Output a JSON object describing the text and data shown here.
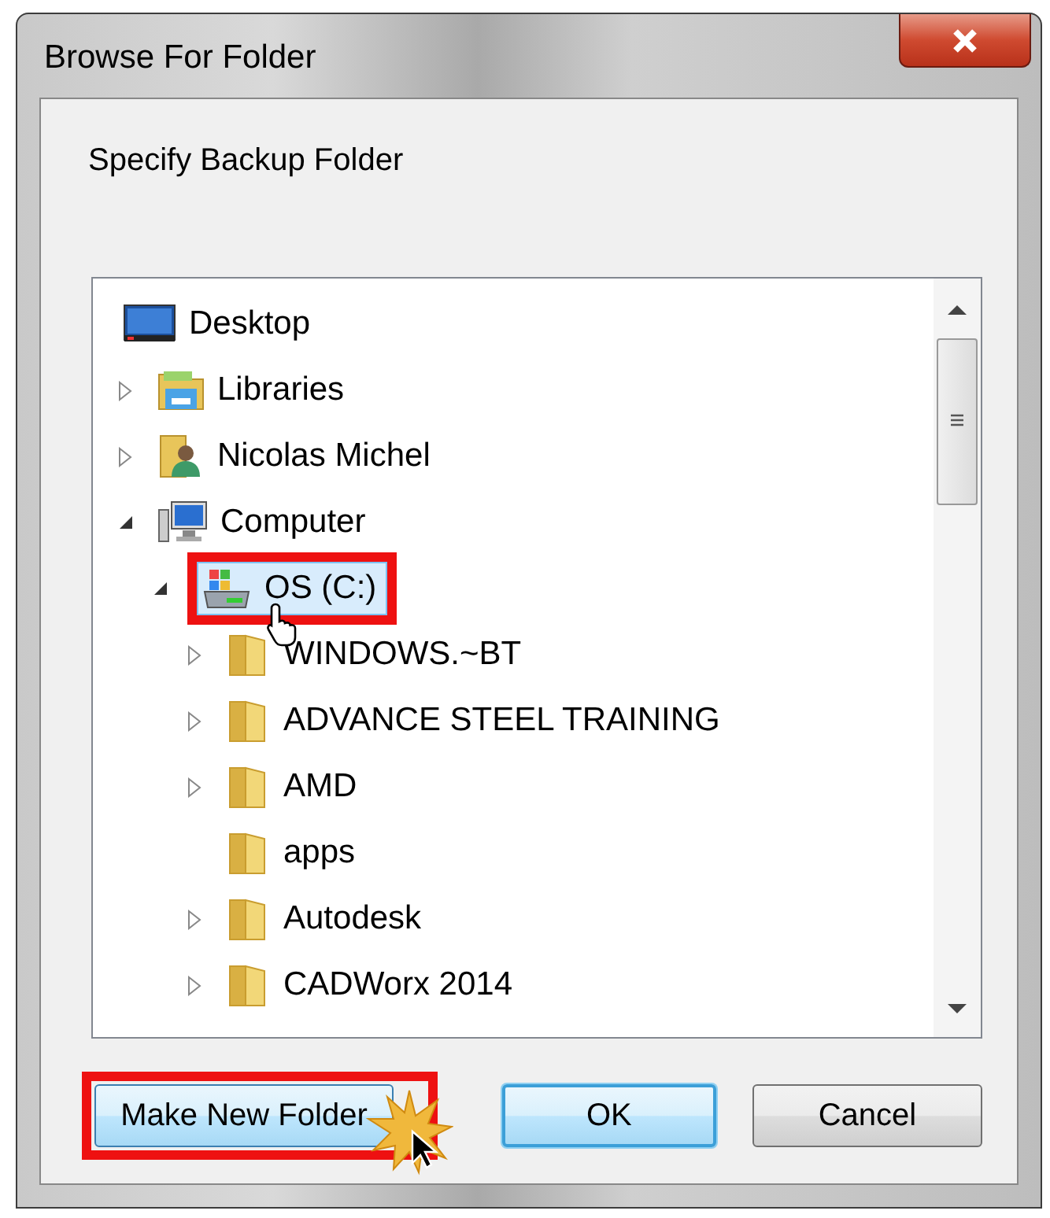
{
  "window": {
    "title": "Browse For Folder"
  },
  "prompt": "Specify Backup Folder",
  "tree": [
    {
      "label": "Desktop",
      "kind": "desktop",
      "selected": false,
      "children": [
        {
          "label": "Libraries",
          "kind": "libraries",
          "expanded": false,
          "selected": false
        },
        {
          "label": "Nicolas Michel",
          "kind": "user",
          "expanded": false,
          "selected": false
        },
        {
          "label": "Computer",
          "kind": "computer",
          "expanded": true,
          "selected": false,
          "children": [
            {
              "label": "OS (C:)",
              "kind": "drive",
              "expanded": true,
              "selected": true,
              "highlighted": true,
              "children": [
                {
                  "label": "WINDOWS.~BT",
                  "kind": "folder",
                  "expanded": false,
                  "selected": false
                },
                {
                  "label": "ADVANCE STEEL TRAINING",
                  "kind": "folder",
                  "expanded": false,
                  "selected": false
                },
                {
                  "label": "AMD",
                  "kind": "folder",
                  "expanded": false,
                  "selected": false
                },
                {
                  "label": "apps",
                  "kind": "folder",
                  "selected": false
                },
                {
                  "label": "Autodesk",
                  "kind": "folder",
                  "expanded": false,
                  "selected": false
                },
                {
                  "label": "CADWorx 2014",
                  "kind": "folder",
                  "expanded": false,
                  "selected": false
                }
              ]
            }
          ]
        }
      ]
    }
  ],
  "buttons": [
    {
      "label": "Make New Folder",
      "kind": "normal",
      "highlighted": true
    },
    {
      "label": "OK",
      "kind": "default"
    },
    {
      "label": "Cancel",
      "kind": "normal"
    }
  ]
}
